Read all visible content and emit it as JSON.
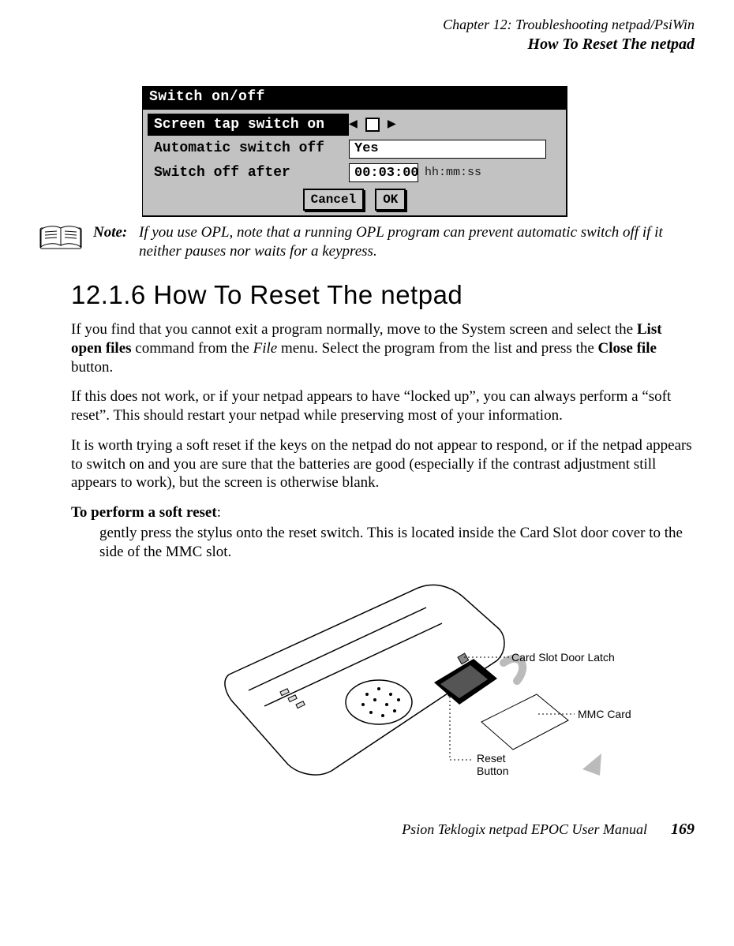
{
  "header": {
    "chapter": "Chapter 12:  Troubleshooting netpad/PsiWin",
    "section": "How To Reset The netpad"
  },
  "dialog": {
    "title": "Switch on/off",
    "rows": {
      "r1_label": "Screen tap switch on",
      "r2_label": "Automatic switch off",
      "r2_value": "Yes",
      "r3_label": "Switch off after",
      "r3_value": "00:03:00",
      "r3_unit": "hh:mm:ss"
    },
    "buttons": {
      "cancel": "Cancel",
      "ok": "OK"
    }
  },
  "note": {
    "label": "Note:",
    "text": "If you use OPL, note that a running OPL program can prevent automatic switch off if it neither pauses nor waits for a keypress."
  },
  "section_heading": "12.1.6  How To Reset The netpad",
  "para1": {
    "a": "If you find that you cannot exit a program normally, move to the System screen and select the ",
    "b": "List open files",
    "c": " command from the ",
    "d": "File",
    "e": " menu. Select the program from the list and press the ",
    "f": "Close file",
    "g": " button."
  },
  "para2": "If this does not work, or if your netpad appears to have “locked up”, you can always perform a “soft reset”. This should restart your netpad while preserving most of your information.",
  "para3": "It is worth trying a soft reset if the keys on the netpad do not appear to respond, or if the netpad appears to switch on and you are sure that the batteries are good (especially if the contrast adjustment still appears to work), but the screen is otherwise blank.",
  "para4": {
    "lead": "To perform a soft reset",
    "colon": ":",
    "body": "gently press the stylus onto the reset switch. This is located inside the Card Slot door cover to the side of the MMC slot."
  },
  "callouts": {
    "latch": "Card Slot Door Latch",
    "mmc": "MMC Card",
    "reset1": "Reset",
    "reset2": "Button"
  },
  "footer": {
    "book": "Psion Teklogix netpad EPOC User Manual",
    "page": "169"
  }
}
